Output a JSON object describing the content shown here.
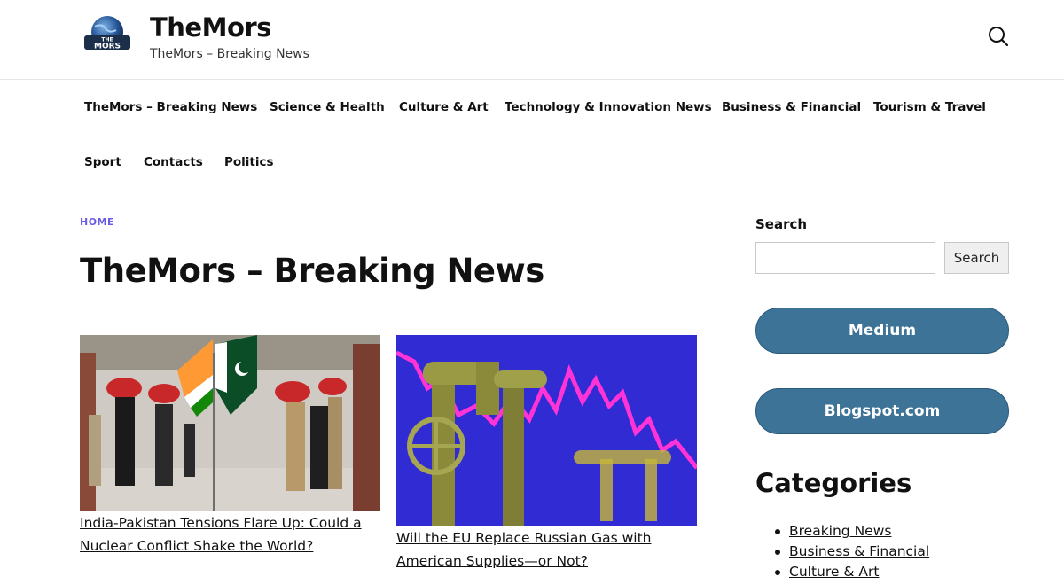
{
  "colors": {
    "accent": "#6b5ce7",
    "pill_button": "#3d7396",
    "text": "#111111"
  },
  "header": {
    "logo_text": "THE MORS",
    "site_title": "TheMors",
    "tagline": "TheMors – Breaking News",
    "search_icon": "search-icon"
  },
  "nav": {
    "items": [
      "TheMors – Breaking News",
      "Science & Health",
      "Culture & Art",
      "Technology & Innovation News",
      "Business & Financial",
      "Tourism & Travel",
      "Sport",
      "Contacts",
      "Politics"
    ]
  },
  "main": {
    "breadcrumb": "HOME",
    "page_title": "TheMors – Breaking News",
    "posts": [
      {
        "title_line1": "India-Pakistan Tensions Flare Up: Could a",
        "title_line2": "Nuclear Conflict Shake the World?"
      },
      {
        "title_line1": "Will the EU Replace Russian Gas with",
        "title_line2": "American Supplies—or Not?"
      }
    ]
  },
  "sidebar": {
    "search_label": "Search",
    "search_placeholder": "",
    "search_button": "Search",
    "buttons": [
      "Medium",
      "Blogspot.com"
    ],
    "categories_title": "Categories",
    "categories": [
      "Breaking News",
      "Business & Financial",
      "Culture & Art"
    ]
  }
}
